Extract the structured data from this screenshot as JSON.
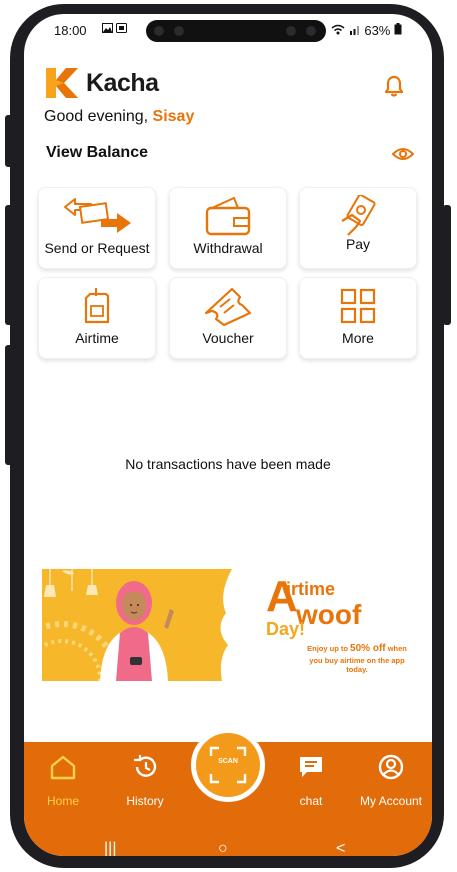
{
  "status_bar": {
    "time": "18:00",
    "battery": "63%",
    "icons": [
      "image-icon",
      "notification-icon",
      "wifi-icon",
      "signal-icon",
      "battery-icon"
    ]
  },
  "app": {
    "brand": "Kacha",
    "accent": "#e8750a",
    "brand_bg": "#e36c0a"
  },
  "greeting": {
    "prefix": "Good evening,",
    "name": "Sisay"
  },
  "balance": {
    "label": "View Balance"
  },
  "actions": [
    {
      "label": "Send or Request",
      "icon": "send-request-icon"
    },
    {
      "label": "Withdrawal",
      "icon": "wallet-icon"
    },
    {
      "label": "Pay",
      "icon": "pay-icon"
    },
    {
      "label": "Airtime",
      "icon": "sim-card-icon"
    },
    {
      "label": "Voucher",
      "icon": "voucher-icon"
    },
    {
      "label": "More",
      "icon": "grid-icon"
    }
  ],
  "transactions": {
    "empty_text": "No transactions have been made"
  },
  "banner": {
    "title_a": "A",
    "title_rest": "irtime",
    "title_woof": "woof",
    "day": "Day!",
    "subtitle_prefix": "Enjoy up to",
    "subtitle_highlight": "50% off",
    "subtitle_suffix": "when you buy airtime on the app today."
  },
  "bottom_nav": {
    "items": [
      {
        "label": "Home",
        "icon": "home-icon",
        "active": true
      },
      {
        "label": "History",
        "icon": "history-icon",
        "active": false
      },
      {
        "label": "chat",
        "icon": "chat-icon",
        "active": false
      },
      {
        "label": "My Account",
        "icon": "account-icon",
        "active": false
      }
    ],
    "scan_label": "SCAN"
  },
  "system_nav": {
    "recent": "|||",
    "home": "○",
    "back": "<"
  }
}
